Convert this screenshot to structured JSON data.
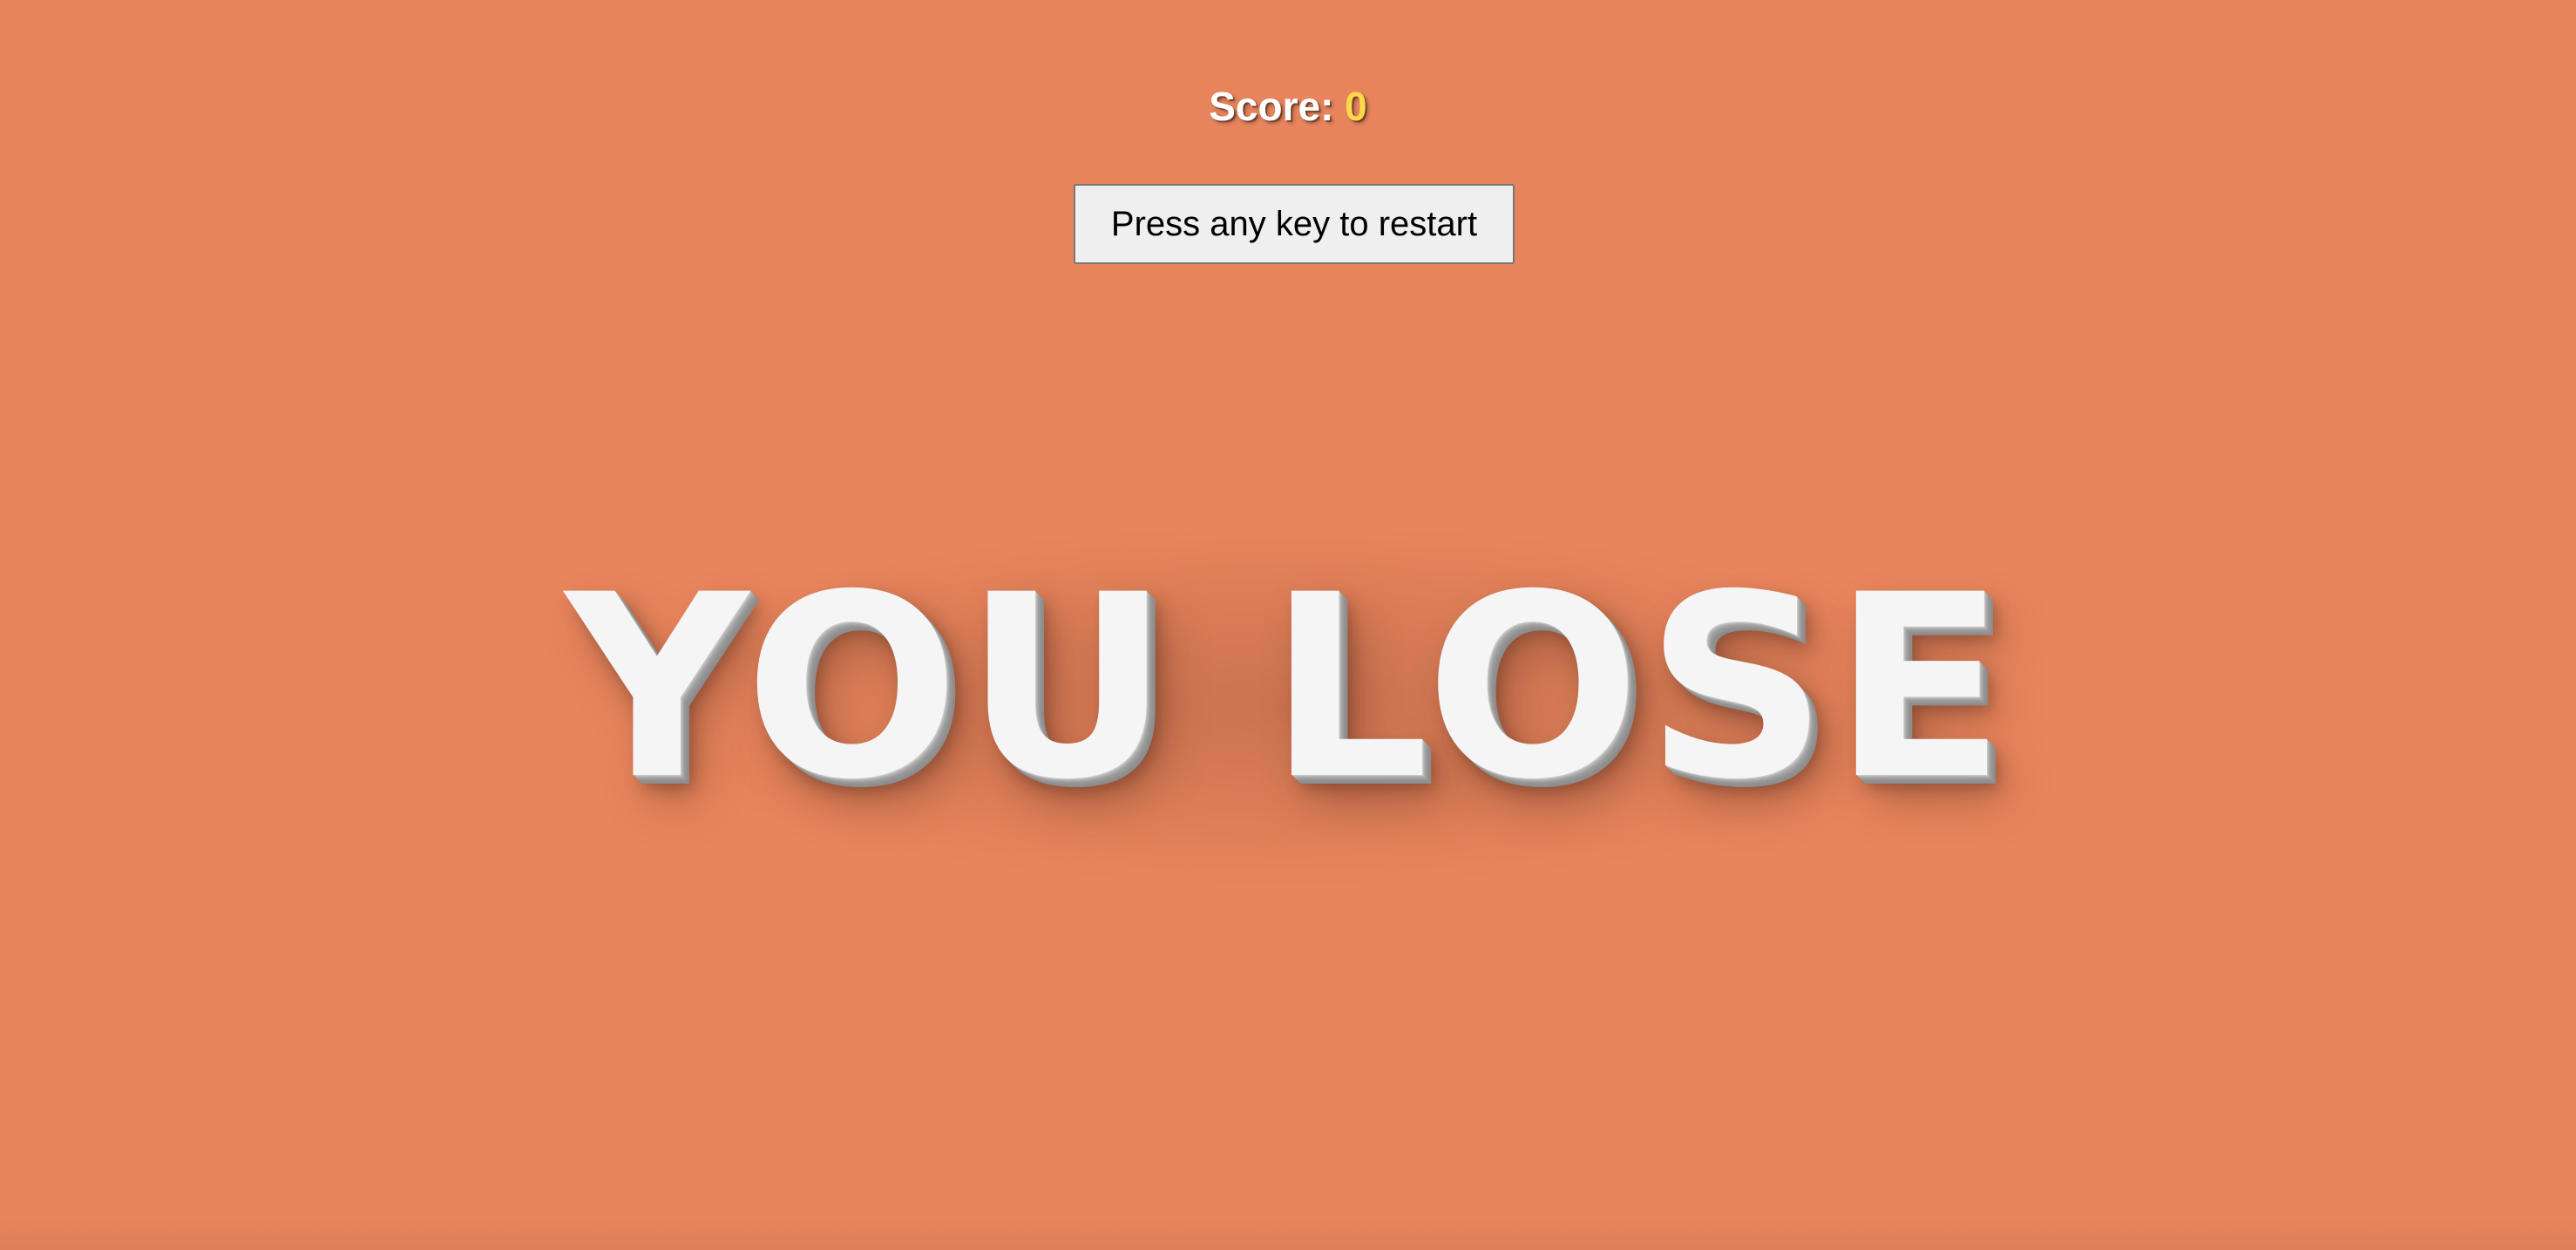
{
  "score": {
    "label": "Score:",
    "value": "0"
  },
  "restart_button": {
    "label": "Press any key to restart"
  },
  "status_message": "YOU LOSE",
  "colors": {
    "background": "#e8855d",
    "score_value": "#ffd84a",
    "message_text": "#f5f5f5"
  }
}
